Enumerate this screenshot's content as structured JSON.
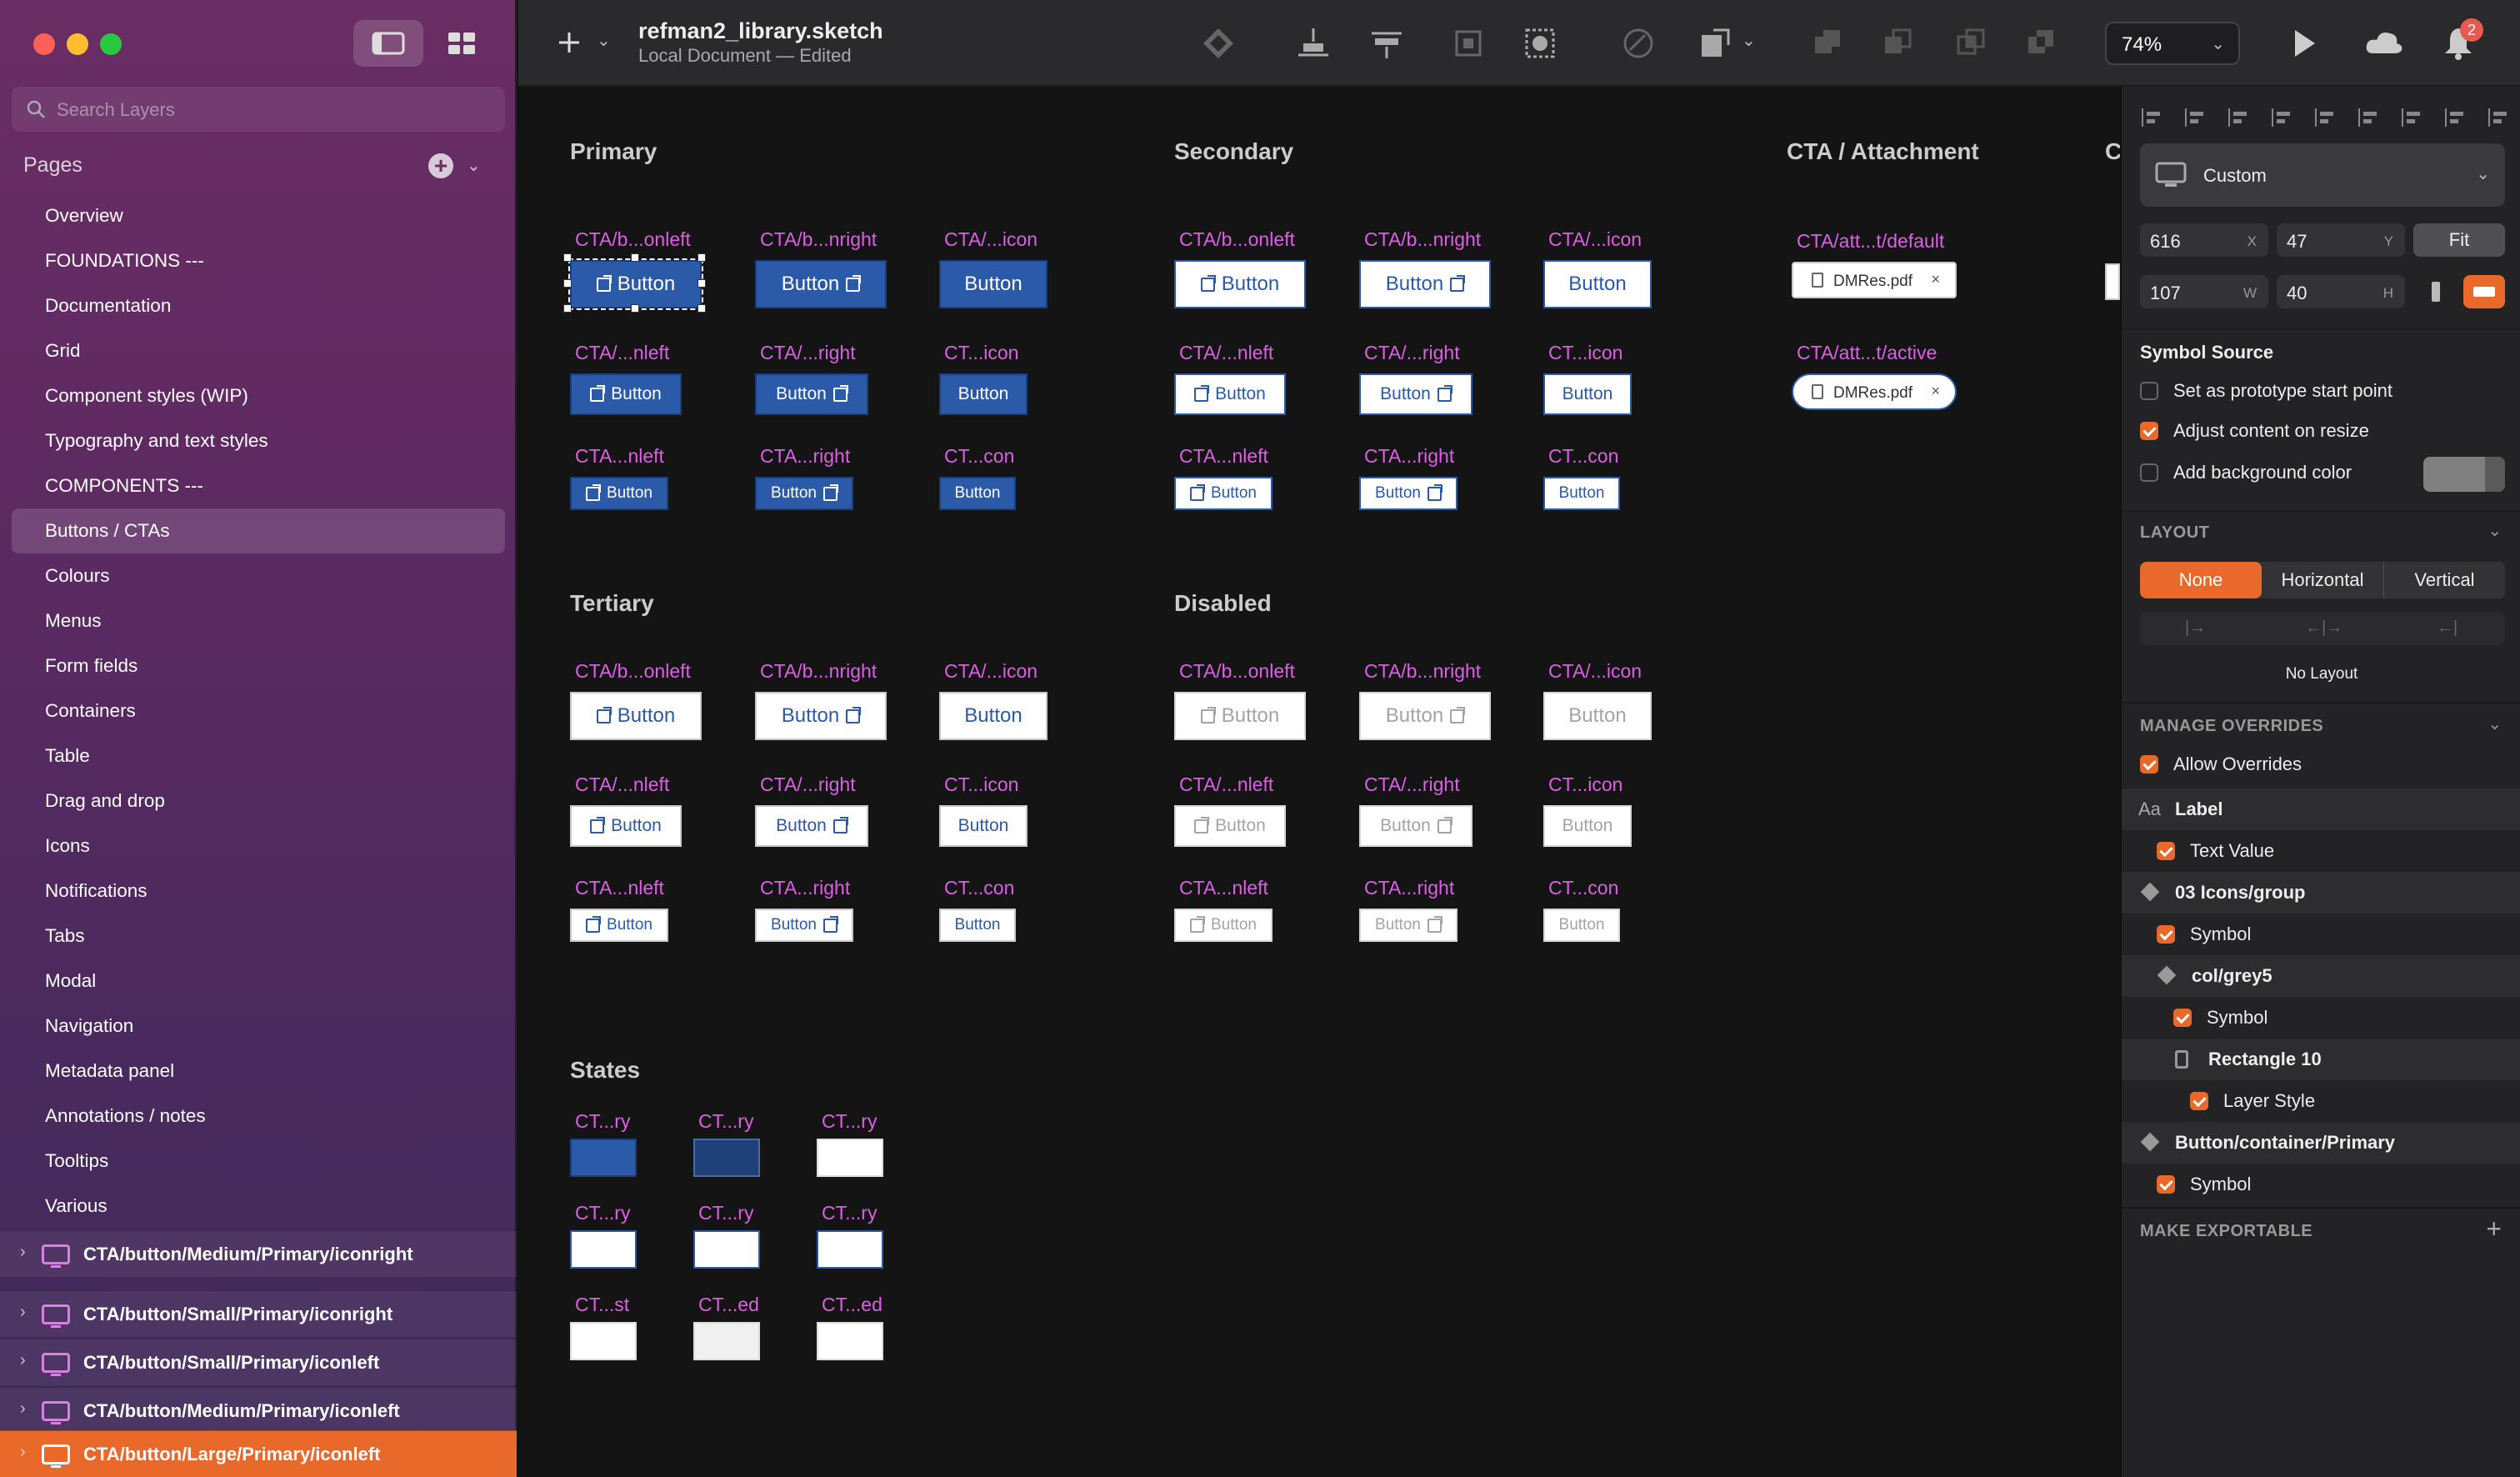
{
  "window": {
    "file_name": "refman2_library.sketch",
    "file_status": "Local Document — Edited",
    "zoom": "74%",
    "notification_count": "2"
  },
  "sidebar": {
    "search_placeholder": "Search Layers",
    "pages_heading": "Pages",
    "pages": [
      "Overview",
      "FOUNDATIONS ---",
      "Documentation",
      "Grid",
      "Component styles (WIP)",
      "Typography and text styles",
      "COMPONENTS ---",
      "Buttons / CTAs",
      "Colours",
      "Menus",
      "Form fields",
      "Containers",
      "Table",
      "Drag and drop",
      "Icons",
      "Notifications",
      "Tabs",
      "Modal",
      "Navigation",
      "Metadata panel",
      "Annotations / notes",
      "Tooltips",
      "Various"
    ],
    "selected_page": "Buttons / CTAs",
    "layers": [
      "CTA/button/Medium/Primary/iconright",
      "CTA/button/Small/Primary/iconright",
      "CTA/button/Small/Primary/iconleft",
      "CTA/button/Medium/Primary/iconleft",
      "CTA/button/Large/Primary/iconleft"
    ]
  },
  "canvas": {
    "sections": {
      "primary": "Primary",
      "secondary": "Secondary",
      "attachment": "CTA / Attachment",
      "tertiary": "Tertiary",
      "disabled": "Disabled",
      "states": "States",
      "cut": "C"
    },
    "row_labels": [
      [
        "CTA/b...onleft",
        "CTA/b...nright",
        "CTA/...icon"
      ],
      [
        "CTA/...nleft",
        "CTA/...right",
        "CT...icon"
      ],
      [
        "CTA...nleft",
        "CTA...right",
        "CT...con"
      ]
    ],
    "button_text": "Button",
    "attachment": {
      "labels": [
        "CTA/att...t/default",
        "CTA/att...t/active"
      ],
      "file": "DMRes.pdf",
      "close": "×"
    },
    "states": {
      "labels": [
        [
          "CT...ry",
          "CT...ry",
          "CT...ry"
        ],
        [
          "CT...ry",
          "CT...ry",
          "CT...ry"
        ],
        [
          "CT...st",
          "CT...ed",
          "CT...ed"
        ]
      ]
    }
  },
  "inspector": {
    "preset": "Custom",
    "x": "616",
    "x_label": "X",
    "y": "47",
    "y_label": "Y",
    "w": "107",
    "w_label": "W",
    "h": "40",
    "h_label": "H",
    "fit": "Fit",
    "symbol_source": "Symbol Source",
    "opt_start": "Set as prototype start point",
    "opt_adjust": "Adjust content on resize",
    "opt_bg": "Add background color",
    "layout_heading": "LAYOUT",
    "layout_opts": [
      "None",
      "Horizontal",
      "Vertical"
    ],
    "no_layout": "No Layout",
    "overrides_heading": "MANAGE OVERRIDES",
    "allow_overrides": "Allow Overrides",
    "overrides": [
      {
        "t": "Label",
        "kind": "group",
        "icon": "Aa"
      },
      {
        "t": "Text Value",
        "kind": "check",
        "indent": 1
      },
      {
        "t": "03 Icons/group",
        "kind": "group",
        "icon": "sym"
      },
      {
        "t": "Symbol",
        "kind": "check",
        "indent": 1
      },
      {
        "t": "col/grey5",
        "kind": "group",
        "icon": "sym",
        "indent": 1
      },
      {
        "t": "Symbol",
        "kind": "check",
        "indent": 2
      },
      {
        "t": "Rectangle 10",
        "kind": "group",
        "icon": "rect",
        "indent": 2
      },
      {
        "t": "Layer Style",
        "kind": "check",
        "indent": 3
      },
      {
        "t": "Button/container/Primary",
        "kind": "group",
        "icon": "sym"
      },
      {
        "t": "Symbol",
        "kind": "check",
        "indent": 1
      }
    ],
    "make_exportable": "MAKE EXPORTABLE"
  },
  "colors": {
    "accent": "#e8692a",
    "primary_button": "#2a5aa8",
    "label": "#dd5fe6",
    "sidebar": "#5d2a62"
  }
}
